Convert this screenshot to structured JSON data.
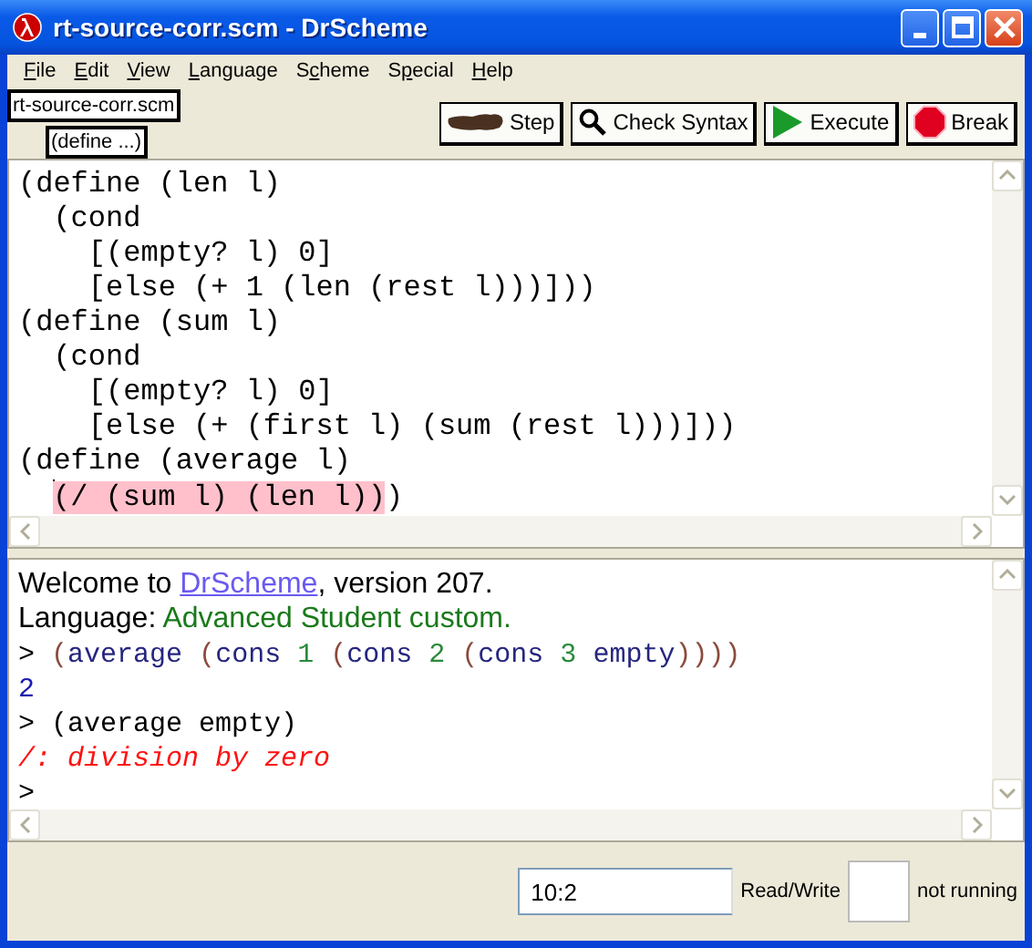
{
  "window": {
    "title": "rt-source-corr.scm - DrScheme"
  },
  "menu": [
    {
      "key": "F",
      "after": "ile"
    },
    {
      "key": "E",
      "after": "dit"
    },
    {
      "key": "V",
      "after": "iew"
    },
    {
      "key": "L",
      "after": "anguage"
    },
    {
      "before": "S",
      "key": "c",
      "after": "heme"
    },
    {
      "before": "S",
      "key": "p",
      "after": "ecial"
    },
    {
      "key": "H",
      "after": "elp"
    }
  ],
  "toolbar": {
    "file_button": "rt-source-corr.scm",
    "definitions_button": "(define ...)",
    "buttons": [
      {
        "label": "Step",
        "kind": "step"
      },
      {
        "label": "Check Syntax",
        "kind": "check"
      },
      {
        "label": "Execute",
        "kind": "execute"
      },
      {
        "label": "Break",
        "kind": "break"
      }
    ]
  },
  "editor": {
    "lines": [
      [
        {
          "text": "(define (len l)",
          "kind": "plain"
        }
      ],
      [
        {
          "text": "  (cond",
          "kind": "plain"
        }
      ],
      [
        {
          "text": "    [(empty? l) 0]",
          "kind": "plain"
        }
      ],
      [
        {
          "text": "    [else (+ 1 (len (rest l)))]))",
          "kind": "plain"
        }
      ],
      [
        {
          "text": "(define (sum l)",
          "kind": "plain"
        }
      ],
      [
        {
          "text": "  (cond",
          "kind": "plain"
        }
      ],
      [
        {
          "text": "    [(empty? l) 0]",
          "kind": "plain"
        }
      ],
      [
        {
          "text": "    [else (+ (first l) (sum (rest l)))]))",
          "kind": "plain"
        }
      ],
      [
        {
          "text": "(define (average l)",
          "kind": "plain"
        }
      ],
      [
        {
          "kind": "cursor"
        },
        {
          "text": "(/ (sum l) (len l))",
          "kind": "highlight"
        },
        {
          "text": ")",
          "kind": "plain"
        }
      ]
    ]
  },
  "interactions": {
    "lines": [
      [
        {
          "text": "Welcome to ",
          "kind": "text"
        },
        {
          "text": "DrScheme",
          "kind": "link"
        },
        {
          "text": ", version 207.",
          "kind": "text"
        }
      ],
      [
        {
          "text": "Language: ",
          "kind": "text"
        },
        {
          "text": "Advanced Student custom.",
          "kind": "language"
        }
      ],
      [
        {
          "text": "> ",
          "kind": "prompt"
        },
        {
          "text": "(",
          "kind": "paren"
        },
        {
          "text": "average",
          "kind": "symbol"
        },
        {
          "text": " (",
          "kind": "paren"
        },
        {
          "text": "cons",
          "kind": "symbol"
        },
        {
          "text": " 1 ",
          "kind": "number"
        },
        {
          "text": "(",
          "kind": "paren"
        },
        {
          "text": "cons",
          "kind": "symbol"
        },
        {
          "text": " 2 ",
          "kind": "number"
        },
        {
          "text": "(",
          "kind": "paren"
        },
        {
          "text": "cons",
          "kind": "symbol"
        },
        {
          "text": " 3 ",
          "kind": "number"
        },
        {
          "text": "empty",
          "kind": "symbol"
        },
        {
          "text": "))))",
          "kind": "paren"
        }
      ],
      [
        {
          "text": "2",
          "kind": "value"
        }
      ],
      [
        {
          "text": "> (average empty)",
          "kind": "prompt"
        }
      ],
      [
        {
          "text": "/: division by zero",
          "kind": "error"
        }
      ],
      [
        {
          "text": ">",
          "kind": "prompt"
        }
      ]
    ]
  },
  "status_bar": {
    "position": "10:2",
    "mode": "Read/Write",
    "state": "not running"
  }
}
